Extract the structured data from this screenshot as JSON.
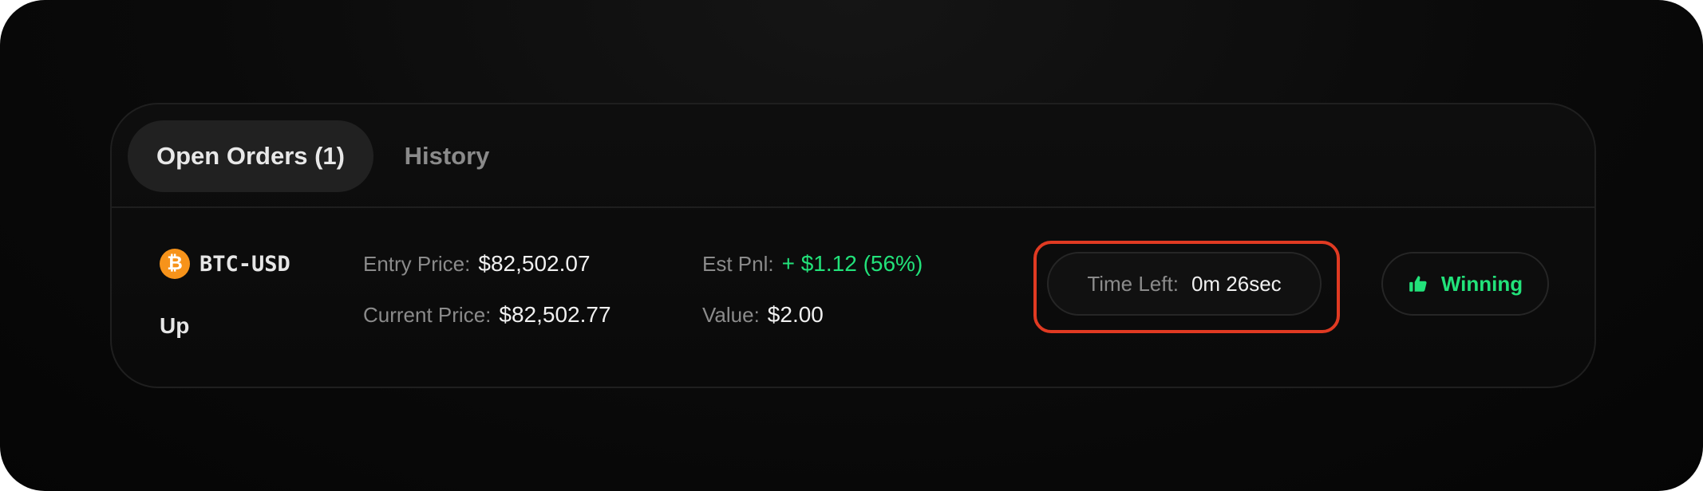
{
  "tabs": [
    {
      "label": "Open Orders (1)",
      "active": true
    },
    {
      "label": "History",
      "active": false
    }
  ],
  "order": {
    "asset_icon": "bitcoin-icon",
    "asset_icon_glyph": "₿",
    "asset": "BTC-USD",
    "direction": "Up",
    "entry_price_label": "Entry Price:",
    "entry_price": "$82,502.07",
    "current_price_label": "Current Price:",
    "current_price": "$82,502.77",
    "est_pnl_label": "Est Pnl:",
    "est_pnl": "+ $1.12 (56%)",
    "value_label": "Value:",
    "value": "$2.00",
    "time_left_label": "Time Left:",
    "time_left": "0m 26sec",
    "status_icon": "thumbs-up-icon",
    "status": "Winning"
  },
  "colors": {
    "positive": "#22e27a",
    "bitcoin": "#f7931a",
    "highlight": "#e03a22"
  }
}
